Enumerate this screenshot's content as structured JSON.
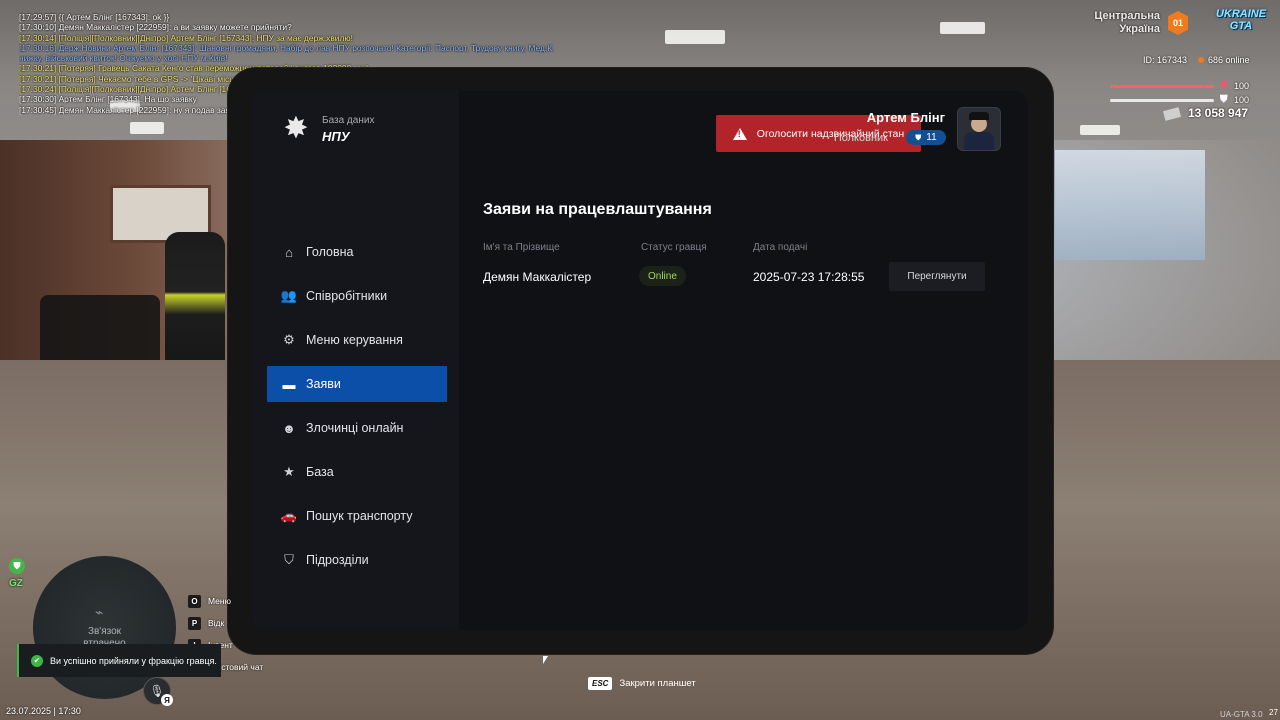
{
  "chat": [
    {
      "text": "[17:29:57] {{ Артем Блінг [167343]: ok }}",
      "color": "c-w"
    },
    {
      "text": "[17:30:10] Демян Маккалістер [222959]: а ви заявку можете прийняти?",
      "color": "c-w"
    },
    {
      "text": "[17:30:14] [Поліція][Полковник][Дніпро] Артем Блінг [167343]: НПУ за має держ.хвилю!",
      "color": "c-y"
    },
    {
      "text": "[17:30:16] Держ.Новини Артем Блінг [167343]: Шановні громадяни, Набір до лав НПУ розпочато! Категорії: Паспорт, Трудову книгу, Мед.К.",
      "color": "c-b"
    },
    {
      "text": "нижку, військовий квиток! Очікуємо у холі НПУ м.Київ!",
      "color": "c-b"
    },
    {
      "text": "[17:30:21] [Потеряя] Гравець Саката Кенго став переможцем потерей і виграв 102000 грн!",
      "color": "c-y"
    },
    {
      "text": "[17:30:21] [Потеряя] Чекаємо тебе в GPS -> 'Цікаві місця' -> 'Казино'",
      "color": "c-y"
    },
    {
      "text": "[17:30:24] [Поліція][Полковник][Дніпро] Артем Блінг [167343]: НПУ звільнили держ.хвилю",
      "color": "c-y"
    },
    {
      "text": "[17:30:30] Артем Блінг [167343]: На що заявку",
      "color": "c-w"
    },
    {
      "text": "[17:30:45] Демян Маккалістер [222959]: ну я подав заявку в поліцію на вході там",
      "color": "c-w"
    }
  ],
  "hud": {
    "region_line1": "Центральна",
    "region_line2": "Україна",
    "region_badge": "01",
    "logo_line1": "UKRAINE",
    "logo_line2": "GTA",
    "player_id": "ID: 167343",
    "online": "686 online",
    "health": "100",
    "armor": "100",
    "money": "13 058 947"
  },
  "tablet": {
    "brand_sub": "База даних",
    "brand_title": "НПУ",
    "alert_button": "Оголосити надзвичайний стан",
    "user_name": "Артем Блінг",
    "user_rank": "Полковник",
    "rank_level": "11",
    "nav": [
      {
        "label": "Головна",
        "icon": "home-icon",
        "glyph": "⌂"
      },
      {
        "label": "Співробітники",
        "icon": "users-icon",
        "glyph": "👥"
      },
      {
        "label": "Меню керування",
        "icon": "gear-icon",
        "glyph": "⚙"
      },
      {
        "label": "Заяви",
        "icon": "folder-icon",
        "glyph": "▬",
        "active": true
      },
      {
        "label": "Злочинці онлайн",
        "icon": "mask-icon",
        "glyph": "☻"
      },
      {
        "label": "База",
        "icon": "star-icon",
        "glyph": "★"
      },
      {
        "label": "Пошук транспорту",
        "icon": "car-icon",
        "glyph": "🚗"
      },
      {
        "label": "Підрозділи",
        "icon": "shield-icon",
        "glyph": "⛉"
      }
    ],
    "page_title": "Заяви на працевлаштування",
    "columns": [
      "Ім'я та Прізвище",
      "Статус гравця",
      "Дата подачі"
    ],
    "rows": [
      {
        "name": "Демян Маккалістер",
        "status": "Online",
        "date": "2025-07-23 17:28:55",
        "action": "Переглянути"
      }
    ]
  },
  "bottom": {
    "esc_key": "ESC",
    "esc_label": "Закрити планшет",
    "minimap_line1": "Зв'язок",
    "minimap_line2": "втрачено",
    "gz": "GZ",
    "keys": [
      {
        "key": "O",
        "label": "Меню"
      },
      {
        "key": "P",
        "label": "Відк"
      },
      {
        "key": "I",
        "label": "Інвент"
      },
      {
        "key": "T",
        "label": "Текстовий чат"
      }
    ],
    "toast": "Ви успішно прийняли у фракцію гравця.",
    "mic_lang": "Я",
    "datetime": "23.07.2025 | 17:30",
    "version": "UA-GTA 3.0",
    "version_right": "27"
  }
}
